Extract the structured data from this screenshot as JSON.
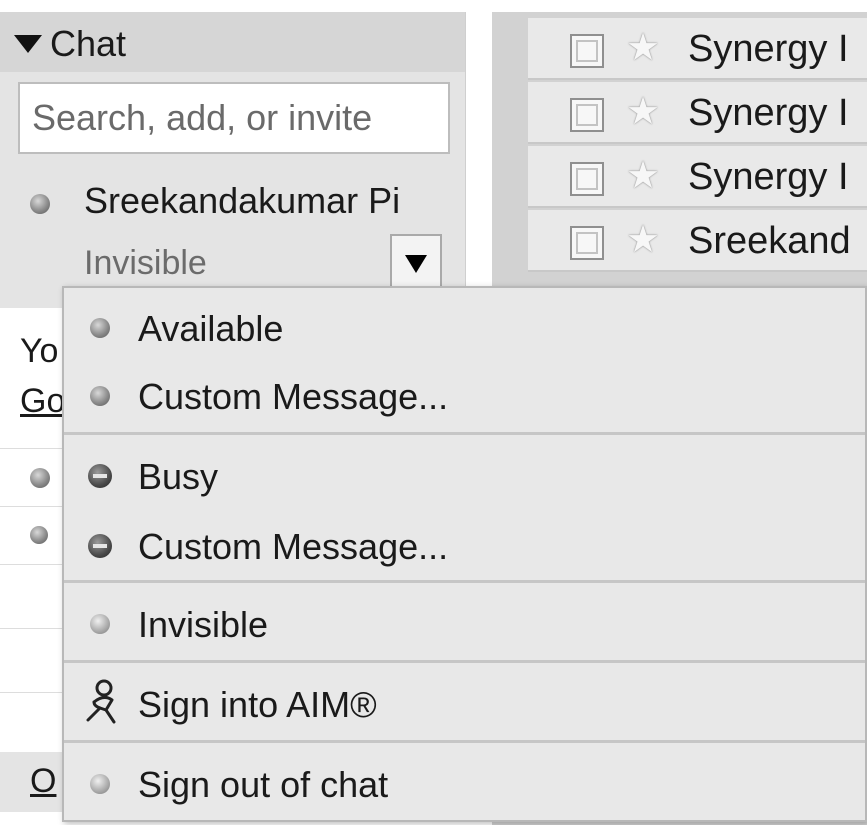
{
  "chat": {
    "title": "Chat",
    "search_placeholder": "Search, add, or invite",
    "me": {
      "name": "Sreekandakumar Pi",
      "status": "Invisible"
    },
    "fragments": {
      "yo": "Yo",
      "go": "Go",
      "footer": "O"
    }
  },
  "mail": {
    "rows": [
      {
        "sender": "Synergy I"
      },
      {
        "sender": "Synergy I"
      },
      {
        "sender": "Synergy I"
      },
      {
        "sender": "Sreekand"
      }
    ]
  },
  "status_menu": {
    "items": [
      {
        "label": "Available",
        "icon": "available-dot-icon"
      },
      {
        "label": "Custom Message...",
        "icon": "available-dot-icon"
      },
      {
        "label": "Busy",
        "icon": "busy-icon"
      },
      {
        "label": "Custom Message...",
        "icon": "busy-icon"
      },
      {
        "label": "Invisible",
        "icon": "invisible-dot-icon"
      },
      {
        "label": "Sign into AIM®",
        "icon": "aim-person-icon"
      },
      {
        "label": "Sign out of chat",
        "icon": "signout-dot-icon"
      }
    ]
  },
  "colors": {
    "panel_bg": "#e4e4e4",
    "menu_bg": "#e8e8e8",
    "row_bg": "#e9e9e9"
  }
}
